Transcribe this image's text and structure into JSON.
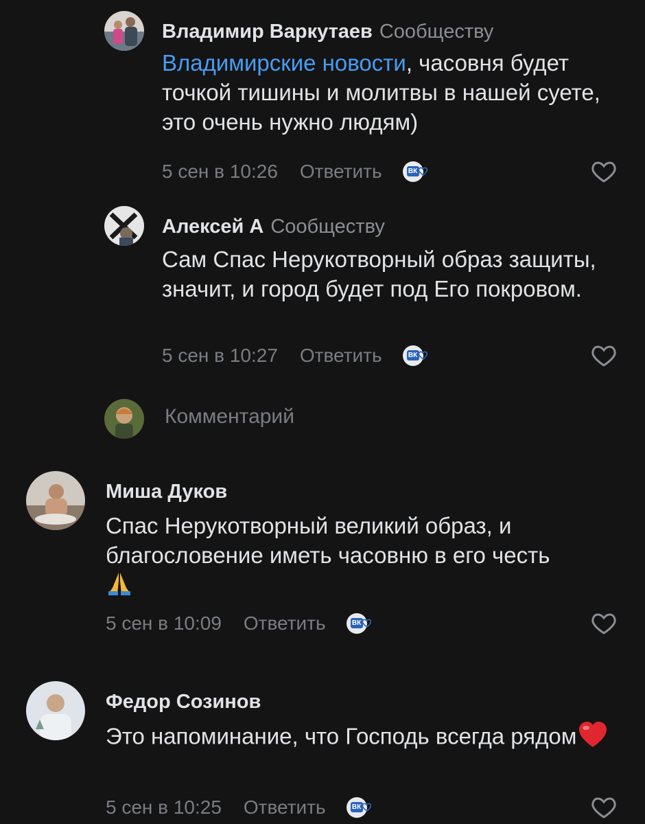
{
  "comments": [
    {
      "author": "Владимир Варкутаев",
      "target": "Сообществу",
      "mention": "Владимирские новости",
      "text": ", часовня будет точкой тишины и молитвы в нашей суете, это очень нужно людям)",
      "date": "5 сен в 10:26",
      "reply_label": "Ответить"
    },
    {
      "author": "Алексей А",
      "target": "Сообществу",
      "text": "Сам Спас Нерукотворный образ защиты, значит, и город будет под Его покровом.",
      "date": "5 сен в 10:27",
      "reply_label": "Ответить"
    },
    {
      "author": "Миша Дуков",
      "text": "Спас Нерукотворный великий образ, и благословение иметь часовню в его честь",
      "emoji": "folded-hands",
      "date": "5 сен в 10:09",
      "reply_label": "Ответить"
    },
    {
      "author": "Федор Созинов",
      "text": "Это напоминание, что Господь всегда рядом",
      "emoji": "red-heart",
      "date": "5 сен в 10:25",
      "reply_label": "Ответить"
    }
  ],
  "composer": {
    "placeholder": "Комментарий"
  },
  "badge_text": "ВК",
  "colors": {
    "background": "#141414",
    "text": "#e1e3e6",
    "secondary": "#7a7d82",
    "link": "#4a9bf2",
    "badge": "#2a63b8"
  }
}
